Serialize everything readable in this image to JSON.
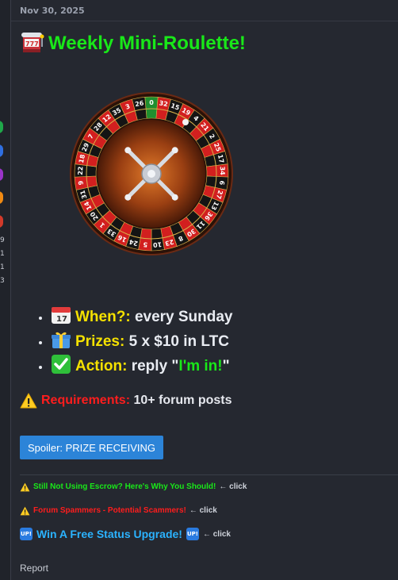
{
  "post": {
    "date": "Nov 30, 2025",
    "title": "Weekly Mini-Roulette!",
    "title_icon": "slot-machine-icon",
    "wheel": {
      "numbers": [
        "0",
        "32",
        "15",
        "19",
        "4",
        "21",
        "2",
        "25",
        "17",
        "34",
        "6",
        "27",
        "13",
        "36",
        "11",
        "30",
        "8",
        "23",
        "10",
        "5",
        "24",
        "16",
        "33",
        "1",
        "20",
        "14",
        "31",
        "9",
        "22",
        "18",
        "29",
        "7",
        "28",
        "12",
        "35",
        "3",
        "26"
      ]
    },
    "bullets": [
      {
        "icon": "calendar-icon",
        "label": "When?:",
        "value": "every Sunday"
      },
      {
        "icon": "gift-icon",
        "label": "Prizes:",
        "value": "5 x $10 in LTC"
      },
      {
        "icon": "check-mark-icon",
        "label": "Action:",
        "value_prefix": "reply \"",
        "value_highlight": "I'm in!",
        "value_suffix": "\""
      }
    ],
    "requirements": {
      "icon": "warning-icon",
      "label": "Requirements:",
      "value": "10+ forum posts"
    },
    "spoiler_label": "Spoiler: PRIZE RECEIVING",
    "report_label": "Report"
  },
  "signature": {
    "line1": {
      "text": "Still Not Using Escrow? Here's Why You Should!",
      "click": "← click"
    },
    "line2": {
      "text": "Forum Spammers - Potential Scammers!",
      "click": "← click"
    },
    "line3": {
      "badge": "UP!",
      "text": "Win A Free Status Upgrade!",
      "click": "← click"
    }
  },
  "gutter": {
    "numbers": [
      "9",
      "1",
      "1",
      "3"
    ],
    "dot_colors": [
      "#1fa84a",
      "#2f6fe0",
      "#9b34c9",
      "#f08a12",
      "#d23a2a"
    ]
  },
  "colors": {
    "green": "#19e819",
    "yellow": "#f5e100",
    "red": "#ff1d1d",
    "cyan": "#2bb3ff",
    "spoiler_bg": "#2c84d8"
  }
}
